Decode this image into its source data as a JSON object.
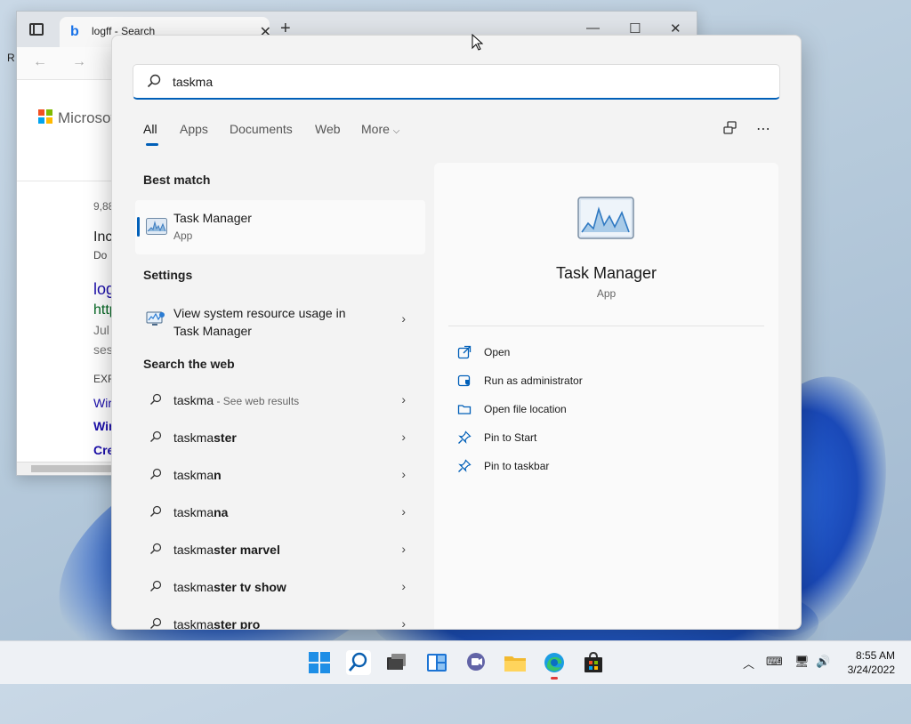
{
  "browser": {
    "tab_title": "logff - Search",
    "logo_text": "Microsoft",
    "edge_letter": "R",
    "snippets": [
      {
        "text": "9,88",
        "color": "#666",
        "size": "12px"
      },
      {
        "text": "Inc",
        "color": "#222",
        "size": "16px"
      },
      {
        "text": "Do",
        "color": "#444",
        "size": "12px"
      },
      {
        "text": "log",
        "color": "#1a0dab",
        "size": "18px"
      },
      {
        "text": "http",
        "color": "#006621",
        "size": "16px"
      },
      {
        "text": "Jul",
        "color": "#777",
        "size": "14px"
      },
      {
        "text": "ses",
        "color": "#777",
        "size": "14px"
      },
      {
        "text": "EXF",
        "color": "#444",
        "size": "12px"
      },
      {
        "text": "Wir",
        "color": "#1a0dab",
        "size": "14px"
      },
      {
        "text": "Wir",
        "color": "#1a0dab",
        "size": "14px",
        "bold": true
      },
      {
        "text": "Cre",
        "color": "#1a0dab",
        "size": "14px",
        "bold": true
      }
    ]
  },
  "search": {
    "query": "taskma",
    "filters": [
      "All",
      "Apps",
      "Documents",
      "Web",
      "More"
    ],
    "active_filter": "All"
  },
  "left": {
    "best_match_heading": "Best match",
    "best_match": {
      "name": "Task Manager",
      "type": "App"
    },
    "settings_heading": "Settings",
    "setting_item": {
      "line1": "View system resource usage in",
      "line2": "Task Manager"
    },
    "web_heading": "Search the web",
    "web_items": [
      {
        "prefix": "taskma",
        "rest": "",
        "suffix": " - See web results"
      },
      {
        "prefix": "taskma",
        "rest": "ster",
        "suffix": ""
      },
      {
        "prefix": "taskma",
        "rest": "n",
        "suffix": ""
      },
      {
        "prefix": "taskma",
        "rest": "na",
        "suffix": ""
      },
      {
        "prefix": "taskma",
        "rest": "ster marvel",
        "suffix": ""
      },
      {
        "prefix": "taskma",
        "rest": "ster tv show",
        "suffix": ""
      },
      {
        "prefix": "taskma",
        "rest": "ster pro",
        "suffix": ""
      }
    ]
  },
  "right": {
    "app_name": "Task Manager",
    "app_type": "App",
    "actions": [
      {
        "label": "Open",
        "icon": "open-icon"
      },
      {
        "label": "Run as administrator",
        "icon": "shield-icon"
      },
      {
        "label": "Open file location",
        "icon": "folder-icon"
      },
      {
        "label": "Pin to Start",
        "icon": "pin-icon"
      },
      {
        "label": "Pin to taskbar",
        "icon": "pin-icon"
      }
    ]
  },
  "taskbar": {
    "time": "8:55 AM",
    "date": "3/24/2022"
  },
  "colors": {
    "accent": "#005fb8",
    "panel_bg": "#f3f3f3"
  }
}
